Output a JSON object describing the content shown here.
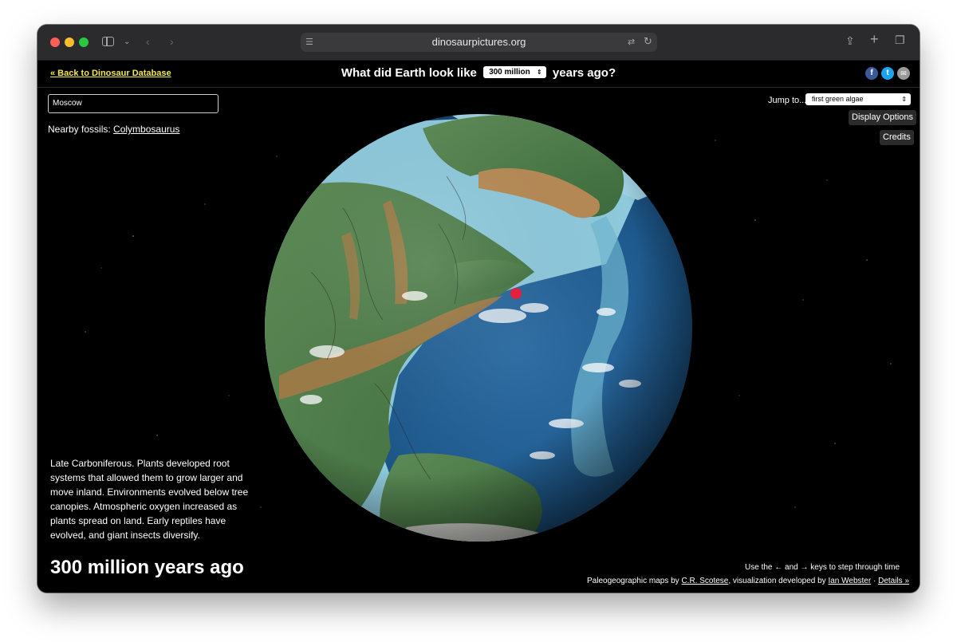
{
  "browser": {
    "url": "dinosaurpictures.org"
  },
  "header": {
    "back_link": "« Back to Dinosaur Database",
    "question_prefix": "What did Earth look like",
    "question_suffix": "years ago?",
    "time_select_value": "300 million"
  },
  "search": {
    "value": "Moscow"
  },
  "nearby": {
    "label": "Nearby fossils:",
    "fossil": "Colymbosaurus"
  },
  "controls": {
    "jump_label": "Jump to...",
    "jump_select_value": "first green algae",
    "display_options": "Display Options",
    "credits": "Credits"
  },
  "description": "Late Carboniferous. Plants developed root systems that allowed them to grow larger and move inland. Environments evolved below tree canopies. Atmospheric oxygen increased as plants spread on land. Early reptiles have evolved, and giant insects diversify.",
  "age_title": "300 million years ago",
  "footer": {
    "hint": "Use the ← and → keys to step through time",
    "credits_prefix": "Paleogeographic maps by",
    "credits_author1": "C.R. Scotese",
    "credits_mid": ", visualization developed by",
    "credits_author2": "Ian Webster",
    "credits_sep": "·",
    "details": "Details »"
  },
  "share": {
    "facebook": "f",
    "twitter": "t",
    "email": "✉"
  },
  "colors": {
    "link_yellow": "#f2e94e",
    "background": "#000000",
    "facebook": "#3b5998",
    "twitter": "#1da1f2",
    "email": "#9a9a9a",
    "marker": "#e3213b"
  }
}
